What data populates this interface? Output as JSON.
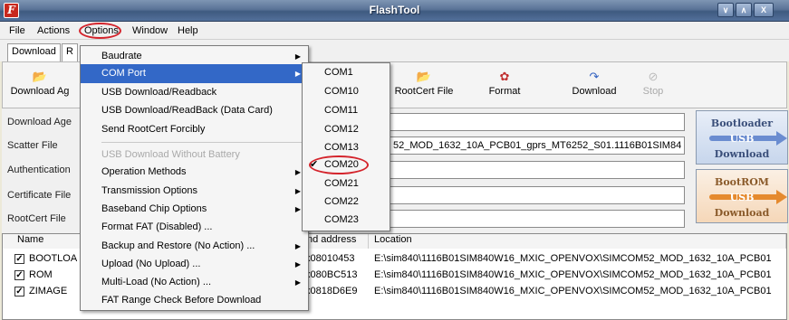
{
  "window": {
    "title": "FlashTool",
    "app_icon_glyph": "F",
    "buttons": [
      "∨",
      "∧",
      "X"
    ]
  },
  "menubar": {
    "items": [
      "File",
      "Actions",
      "Options",
      "Window",
      "Help"
    ]
  },
  "tabs": [
    "Download",
    "R"
  ],
  "toolbar": {
    "buttons": [
      {
        "label": "Download Ag",
        "icon": "folder-open-icon"
      },
      {
        "label": "RootCert File",
        "icon": "folder-open-icon"
      },
      {
        "label": "Format",
        "icon": "format-icon"
      },
      {
        "label": "Download",
        "icon": "download-icon"
      },
      {
        "label": "Stop",
        "icon": "stop-icon"
      }
    ]
  },
  "fields": [
    {
      "label": "Download Age",
      "value": ""
    },
    {
      "label": "Scatter File",
      "value": "52_MOD_1632_10A_PCB01_gprs_MT6252_S01.1116B01SIM84"
    },
    {
      "label": "Authentication",
      "value": ""
    },
    {
      "label": "Certificate File",
      "value": ""
    },
    {
      "label": "RootCert File",
      "value": ""
    }
  ],
  "side_buttons": [
    {
      "name": "bootloader",
      "lines": [
        "Bootloader",
        "USB",
        "Download"
      ]
    },
    {
      "name": "bootrom",
      "lines": [
        "BootROM",
        "USB",
        "Download"
      ]
    }
  ],
  "table": {
    "headers": [
      "Name",
      "nd address",
      "Location"
    ],
    "rows": [
      {
        "name": "BOOTLOA",
        "end": "x08010453",
        "location": "E:\\sim840\\1116B01SIM840W16_MXIC_OPENVOX\\SIMCOM52_MOD_1632_10A_PCB01"
      },
      {
        "name": "ROM",
        "end": "x080BC513",
        "location": "E:\\sim840\\1116B01SIM840W16_MXIC_OPENVOX\\SIMCOM52_MOD_1632_10A_PCB01"
      },
      {
        "name": "ZIMAGE",
        "end": "x0818D6E9",
        "location": "E:\\sim840\\1116B01SIM840W16_MXIC_OPENVOX\\SIMCOM52_MOD_1632_10A_PCB01"
      }
    ]
  },
  "options_menu": {
    "items": [
      {
        "label": "Baudrate",
        "submenu": true
      },
      {
        "label": "COM Port",
        "submenu": true,
        "highlighted": true
      },
      {
        "label": "USB Download/Readback"
      },
      {
        "label": "USB Download/ReadBack (Data Card)"
      },
      {
        "label": "Send RootCert Forcibly"
      },
      {
        "label": "USB Download Without Battery",
        "disabled": true
      },
      {
        "label": "Operation Methods",
        "submenu": true
      },
      {
        "label": "Transmission Options",
        "submenu": true
      },
      {
        "label": "Baseband Chip Options",
        "submenu": true
      },
      {
        "label": "Format FAT (Disabled) ..."
      },
      {
        "label": "Backup and Restore (No Action) ...",
        "submenu": true
      },
      {
        "label": "Upload (No Upload) ...",
        "submenu": true
      },
      {
        "label": "Multi-Load (No Action) ...",
        "submenu": true
      },
      {
        "label": "FAT Range Check Before Download"
      }
    ]
  },
  "com_menu": {
    "items": [
      "COM1",
      "COM10",
      "COM11",
      "COM12",
      "COM13",
      "COM20",
      "COM21",
      "COM22",
      "COM23"
    ],
    "selected": "COM20"
  }
}
